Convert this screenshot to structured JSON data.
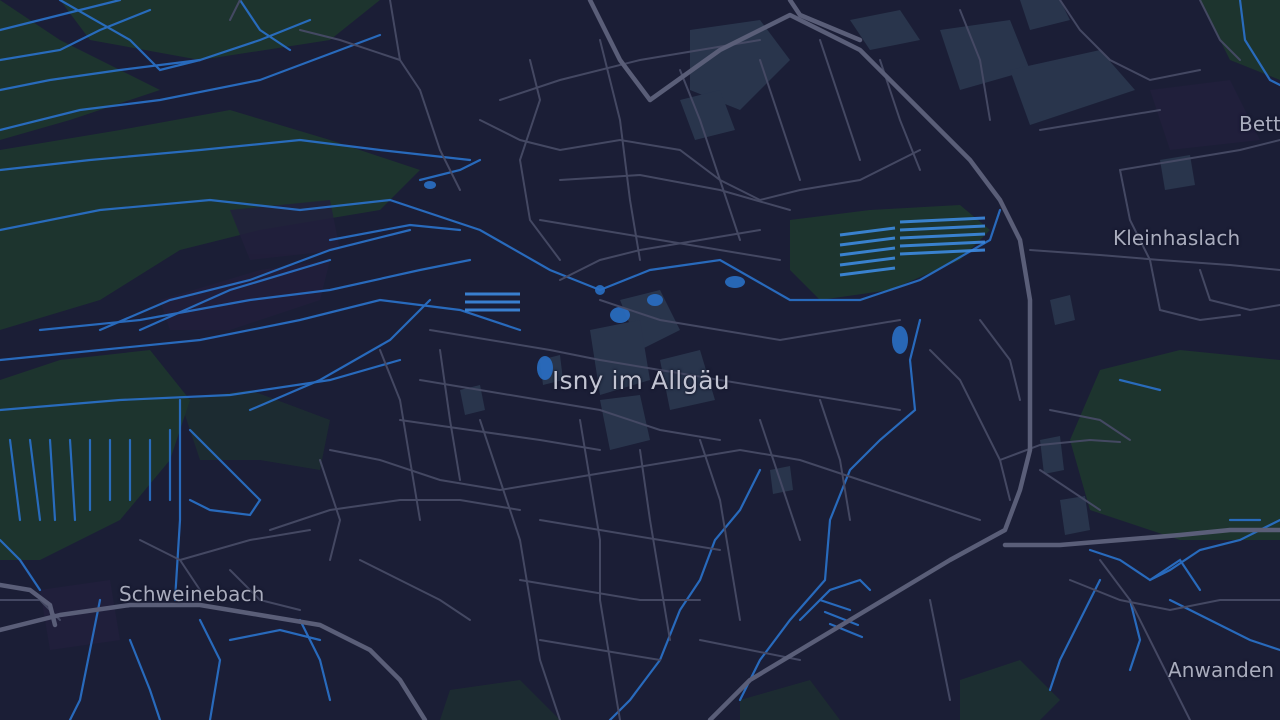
{
  "map": {
    "theme": "dark",
    "colors": {
      "background": "#1b1e36",
      "forest": "#1f3a2e",
      "forest_dark": "#1c3030",
      "water": "#2a6fc4",
      "water_light": "#3d8ae0",
      "road_minor": "#474b66",
      "road_major": "#5a5e78",
      "building": "#2e3a52",
      "label": "#b9bccb"
    },
    "labels": {
      "town_main": "Isny im Allgäu",
      "kleinhaslach": "Kleinhaslach",
      "schweinebach": "Schweinebach",
      "anwanden": "Anwanden",
      "bett": "Bett"
    }
  }
}
